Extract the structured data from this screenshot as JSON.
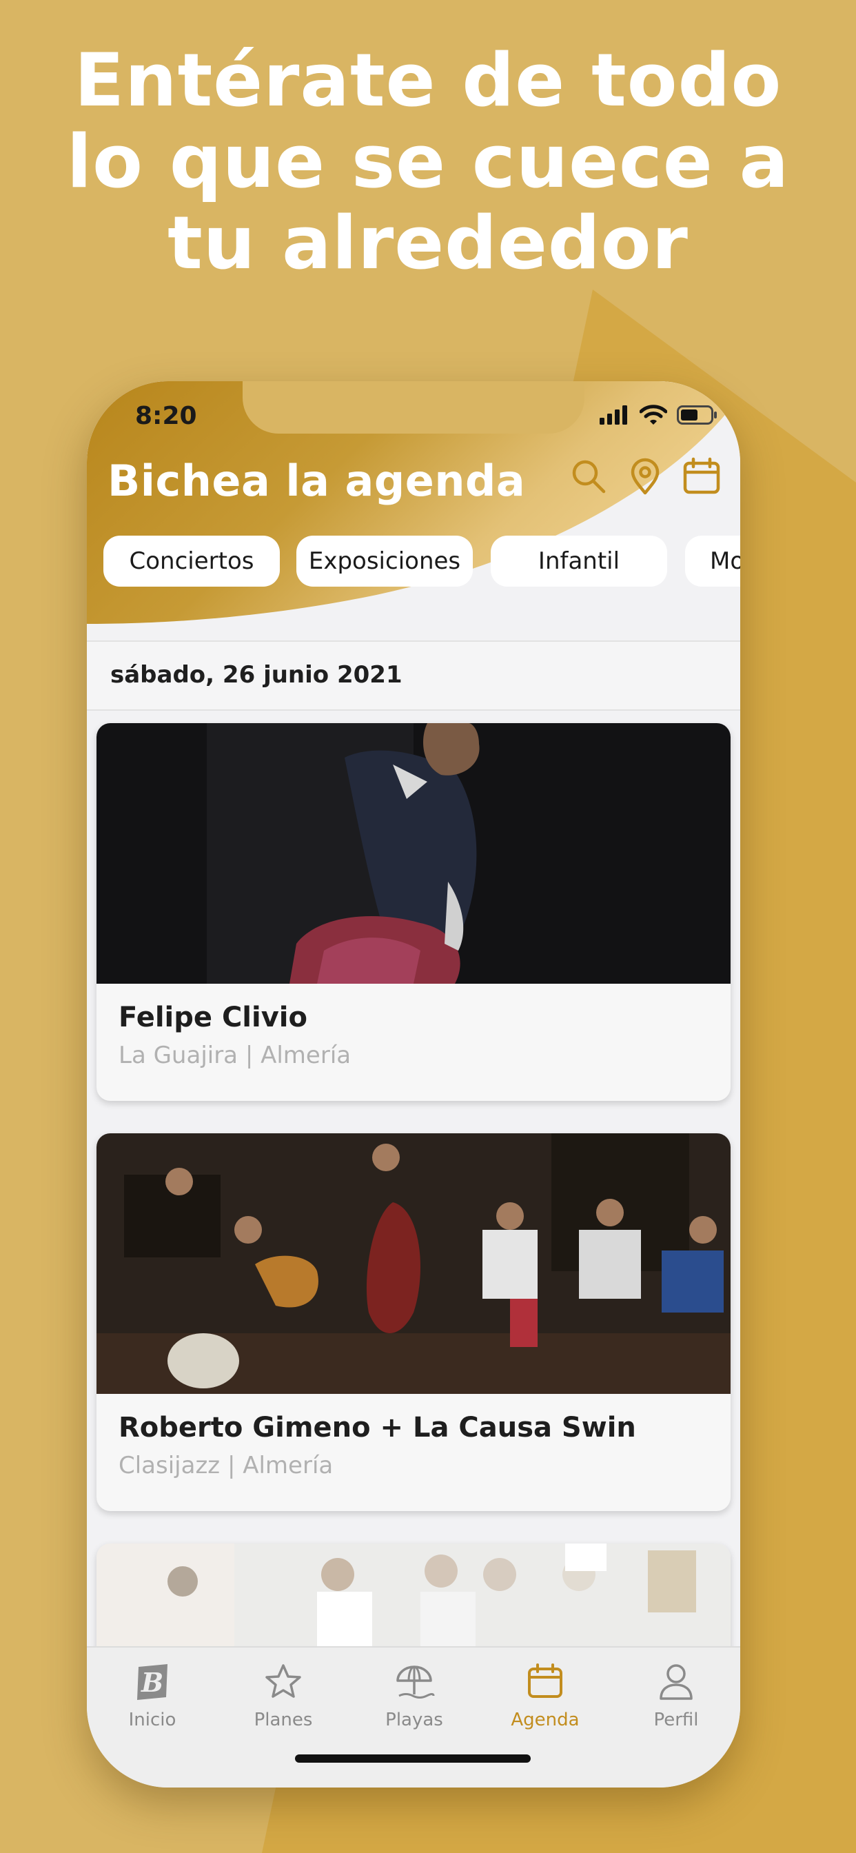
{
  "promo": {
    "headline_lines": [
      "Entérate de todo",
      "lo que se cuece a",
      "tu alrededor"
    ]
  },
  "colors": {
    "background": "#d9b563",
    "accent": "#c28d1e",
    "header_gold": "#b8861c",
    "tab_inactive": "#8a8a8a"
  },
  "status_bar": {
    "time": "8:20"
  },
  "header": {
    "title": "Bichea la agenda",
    "icons": [
      "search-icon",
      "location-pin-icon",
      "calendar-icon"
    ]
  },
  "categories": [
    "Conciertos",
    "Exposiciones",
    "Infantil",
    "Mo"
  ],
  "date_header": "sábado, 26 junio 2021",
  "events": [
    {
      "title": "Felipe Clivio",
      "subtitle": "La Guajira | Almería"
    },
    {
      "title": "Roberto Gimeno + La Causa Swin",
      "subtitle": "Clasijazz | Almería"
    }
  ],
  "tabs": [
    {
      "label": "Inicio",
      "icon": "home-logo-icon",
      "active": false
    },
    {
      "label": "Planes",
      "icon": "star-icon",
      "active": false
    },
    {
      "label": "Playas",
      "icon": "beach-umbrella-icon",
      "active": false
    },
    {
      "label": "Agenda",
      "icon": "calendar-icon",
      "active": true
    },
    {
      "label": "Perfil",
      "icon": "user-icon",
      "active": false
    }
  ]
}
